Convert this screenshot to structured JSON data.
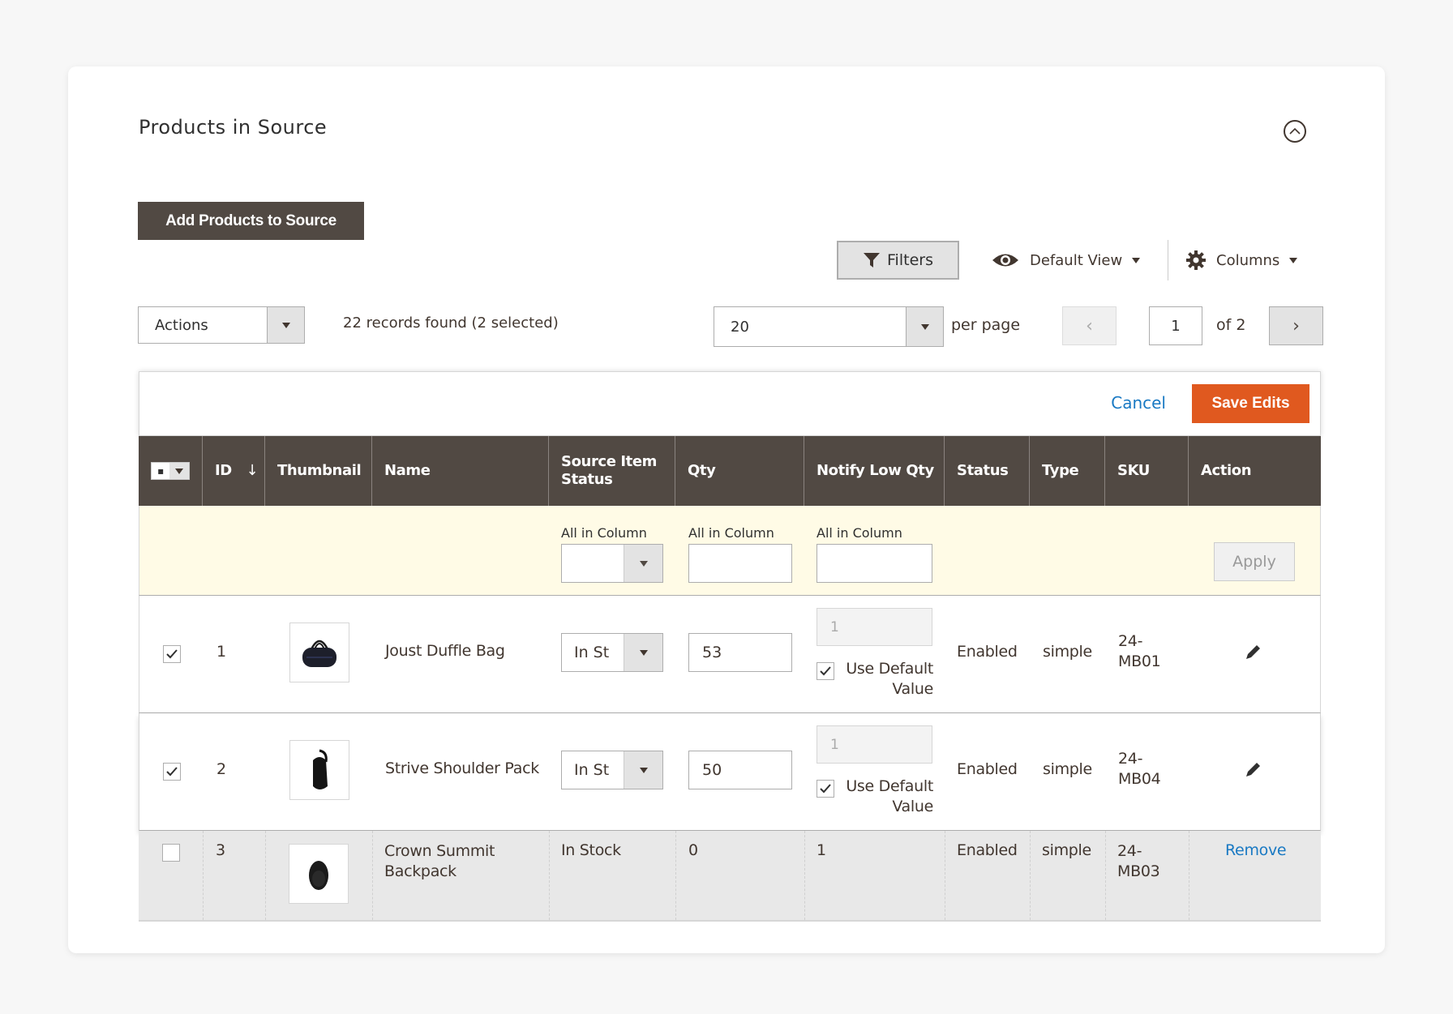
{
  "section": {
    "title": "Products in Source",
    "collapse_icon": "chevron-up-circle-icon",
    "add_button": "Add Products to Source"
  },
  "toolbar": {
    "filters_label": "Filters",
    "view_label": "Default View",
    "columns_label": "Columns",
    "actions_value": "Actions",
    "records_text": "22 records found (2 selected)",
    "per_page_value": "20",
    "per_page_label": "per page",
    "page_value": "1",
    "page_of": "of 2"
  },
  "edit_bar": {
    "cancel_label": "Cancel",
    "save_label": "Save Edits"
  },
  "colors": {
    "header_bg": "#514943",
    "save_button": "#e0591f",
    "link": "#1979c3",
    "edit_all_row_bg": "#fffbe6"
  },
  "table": {
    "columns": [
      "ID",
      "Thumbnail",
      "Name",
      "Source Item Status",
      "Qty",
      "Notify Low Qty",
      "Status",
      "Type",
      "SKU",
      "Action"
    ],
    "sort_indicator": "↓",
    "all_in_column": {
      "label": "All in Column",
      "source_status_value": "",
      "qty_value": "",
      "notify_value": "",
      "apply_label": "Apply"
    },
    "editing_rows": [
      {
        "checked": true,
        "id": "1",
        "name": "Joust Duffle Bag",
        "source_item_status": "In St",
        "qty": "53",
        "notify_low_qty": "1",
        "use_default_label": "Use Default Value",
        "use_default_checked": true,
        "status": "Enabled",
        "type": "simple",
        "sku": "24-MB01",
        "action_icon": "pencil-icon"
      },
      {
        "checked": true,
        "id": "2",
        "name": "Strive Shoulder Pack",
        "source_item_status": "In St",
        "qty": "50",
        "notify_low_qty": "1",
        "use_default_label": "Use Default Value",
        "use_default_checked": true,
        "status": "Enabled",
        "type": "simple",
        "sku": "24-MB04",
        "action_icon": "pencil-icon"
      }
    ],
    "rows": [
      {
        "checked": false,
        "id": "3",
        "name": "Crown Summit Backpack",
        "source_item_status": "In Stock",
        "qty": "0",
        "notify_low_qty": "1",
        "status": "Enabled",
        "type": "simple",
        "sku": "24-MB03",
        "action": "Remove"
      }
    ]
  }
}
